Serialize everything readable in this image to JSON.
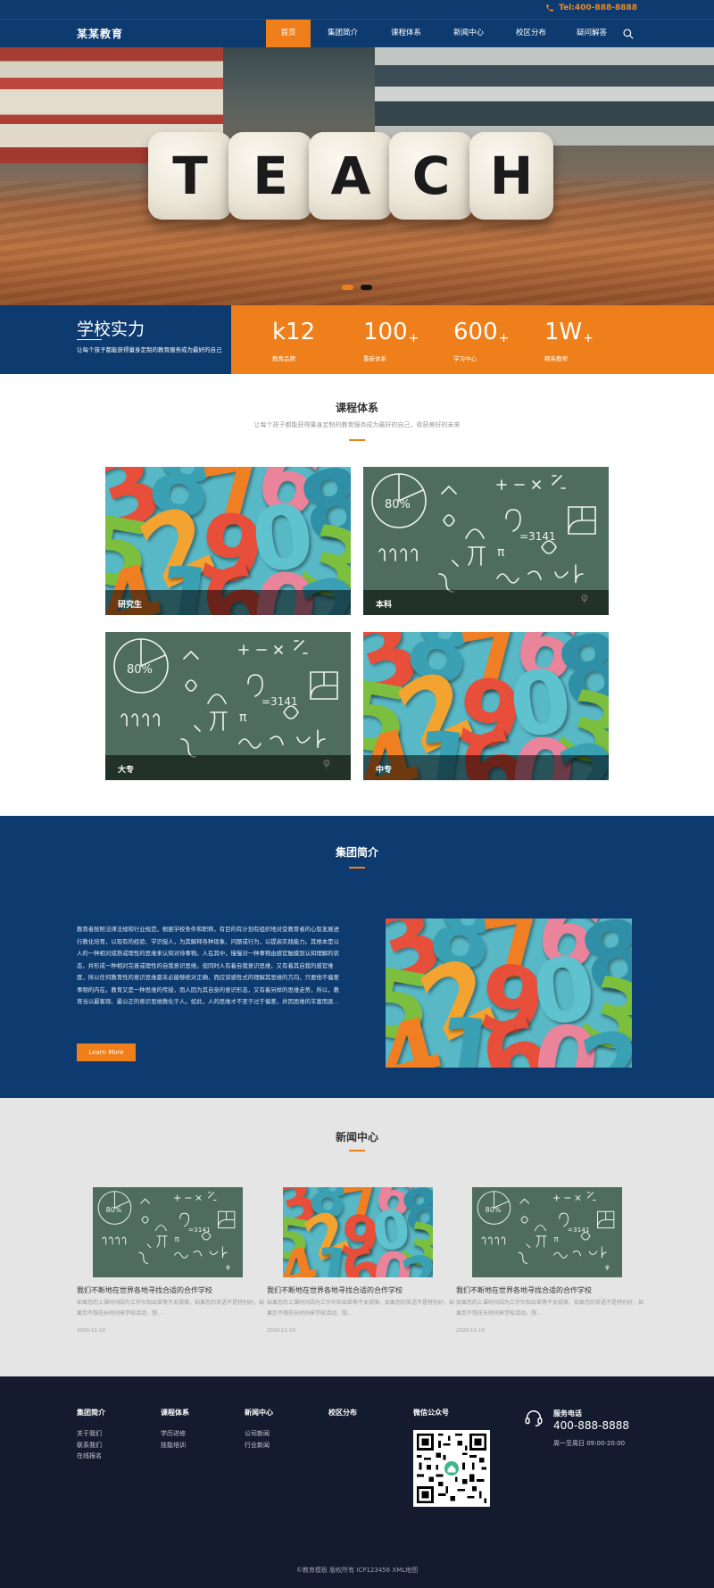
{
  "header": {
    "phone": "Tel:400-888-8888",
    "logo": "某某教育",
    "nav": [
      {
        "label": "首页",
        "active": true
      },
      {
        "label": "集团简介",
        "active": false
      },
      {
        "label": "课程体系",
        "active": false
      },
      {
        "label": "新闻中心",
        "active": false
      },
      {
        "label": "校区分布",
        "active": false
      },
      {
        "label": "疑问解答",
        "active": false
      }
    ]
  },
  "banner": {
    "dice_letters": [
      "T",
      "E",
      "A",
      "C",
      "H"
    ],
    "slides": 2,
    "active_slide": 2
  },
  "strength": {
    "title": "学校实力",
    "subtitle": "让每个孩子都能获得量身定制的教育服务成为最好的自己",
    "stats": [
      {
        "value": "k12",
        "suffix": "",
        "label": "教育品牌"
      },
      {
        "value": "100",
        "suffix": "+",
        "label": "重新体系"
      },
      {
        "value": "600",
        "suffix": "+",
        "label": "学习中心"
      },
      {
        "value": "1W",
        "suffix": "+",
        "label": "精英教师"
      }
    ]
  },
  "courses": {
    "title": "课程体系",
    "subtitle": "让每个孩子都能获得量身定制的教育服务成为最好的自己，收获美好的未来",
    "items": [
      {
        "label": "研究生",
        "image": "colorful-numbers"
      },
      {
        "label": "本科",
        "image": "chalkboard-math"
      },
      {
        "label": "大专",
        "image": "chalkboard-math"
      },
      {
        "label": "中专",
        "image": "colorful-numbers"
      }
    ]
  },
  "about": {
    "title": "集团简介",
    "text": "教育者按照法律法规和行业规范，根据学校条件和职称，有目的有计划有组织地对受教育者的心智发展进行教化培育，以现有的经验、学识授人，为其解释各种现象、问题或行为，以提高实践能力。其根本是以人的一种相对成熟或理性的思维来认知对待事物。人在其中，慢慢对一种事物由感官触摸到认知理解的状态，并形成一种相对完善或理性的自我意识思维。但同时人有着自我意识思维，又有着其自我的感官维度，所以任何教育性的意识思维都未必能够绝对正确，而应该感性式的理解其思维的方向，只要他不偏差事物的内在。教育又是一种思维的传授，而人因为其自身的意识形态，又有着另样的思维走势，所以，教育当以最客观、最公正的意识思维教化于人。如此，人的思维才不至于过于偏差，并因思维的丰富而逐...",
    "button": "Learn More",
    "image": "colorful-numbers"
  },
  "news": {
    "title": "新闻中心",
    "items": [
      {
        "title": "我们不断地在世界各地寻找合适的合作学校",
        "desc": "如果您的上课时间因为工作忙和出差等不太规律，如果您的英语不是特别好，如果您不想花长时间来学校活动，想...",
        "date": "2020-11-10",
        "image": "chalkboard-math"
      },
      {
        "title": "我们不断地在世界各地寻找合适的合作学校",
        "desc": "如果您的上课时间因为工作忙和出差等不太规律，如果您的英语不是特别好，如果您不想花长时间来学校活动，想...",
        "date": "2020-11-10",
        "image": "colorful-numbers"
      },
      {
        "title": "我们不断地在世界各地寻找合适的合作学校",
        "desc": "如果您的上课时间因为工作忙和出差等不太规律，如果您的英语不是特别好，如果您不想花长时间来学校活动，想...",
        "date": "2020-11-10",
        "image": "chalkboard-math"
      }
    ]
  },
  "footer": {
    "columns": [
      {
        "heading": "集团简介",
        "links": [
          "关于我们",
          "联系我们",
          "在线报名"
        ]
      },
      {
        "heading": "课程体系",
        "links": [
          "学历进修",
          "技能培训"
        ]
      },
      {
        "heading": "新闻中心",
        "links": [
          "公司新闻",
          "行业新闻"
        ]
      },
      {
        "heading": "校区分布",
        "links": []
      },
      {
        "heading": "微信公众号",
        "links": []
      }
    ],
    "service": {
      "heading": "服务电话",
      "phone": "400-888-8888",
      "hours": "周一至周日 09:00-20:00"
    },
    "copyright": "©教育模板 版权所有  ICP123456  XML地图"
  },
  "colors": {
    "navy": "#0d3a6f",
    "orange": "#ef7f1a",
    "footer": "#141b2e",
    "news_bg": "#e5e5e5"
  }
}
